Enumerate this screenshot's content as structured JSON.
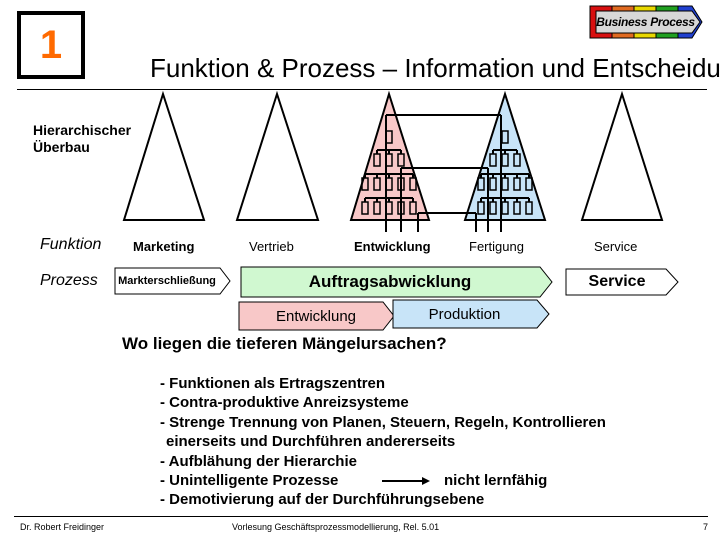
{
  "slide_number_badge": "1",
  "logo": {
    "label": "Business Process",
    "stripe_colors": [
      "#d81010",
      "#e06a20",
      "#e8d800",
      "#20a020",
      "#2040d0"
    ]
  },
  "title": "Funktion & Prozess – Information und Entscheidung",
  "hierarchy_label": [
    "Hierarchischer",
    "Überbau"
  ],
  "row_labels": {
    "function": "Funktion",
    "process": "Prozess"
  },
  "functions": [
    "Marketing",
    "Vertrieb",
    "Entwicklung",
    "Fertigung",
    "Service"
  ],
  "pyramids": [
    {
      "name": "Marketing",
      "fill": "#ffffff"
    },
    {
      "name": "Vertrieb",
      "fill": "#ffffff"
    },
    {
      "name": "Entwicklung",
      "fill": "#f8c8c8"
    },
    {
      "name": "Fertigung",
      "fill": "#c8e4f8"
    },
    {
      "name": "Service",
      "fill": "#ffffff"
    }
  ],
  "processes": {
    "markterschliessung": {
      "label": "Markterschließung",
      "fill": "#ffffff"
    },
    "auftragsabwicklung": {
      "label": "Auftragsabwicklung",
      "fill": "#d0f8d0"
    },
    "service": {
      "label": "Service",
      "fill": "#ffffff"
    },
    "entwicklung": {
      "label": "Entwicklung",
      "fill": "#f8c8c8"
    },
    "produktion": {
      "label": "Produktion",
      "fill": "#c8e4f8"
    }
  },
  "question": "Wo liegen die tieferen Mängelursachen?",
  "causes": [
    "- Funktionen als Ertragszentren",
    "- Contra-produktive Anreizsysteme",
    "- Strenge Trennung von Planen, Steuern, Regeln, Kontrollieren",
    "  einerseits und Durchführen andererseits",
    "- Aufblähung der Hierarchie",
    "- Unintelligente Prozesse",
    "- Demotivierung auf der Durchführungsebene"
  ],
  "cause_arrow_target": "nicht lernfähig",
  "footer": {
    "author": "Dr. Robert Freidinger",
    "course": "Vorlesung Geschäftsprozessmodellierung, Rel. 5.01",
    "page": "7"
  }
}
